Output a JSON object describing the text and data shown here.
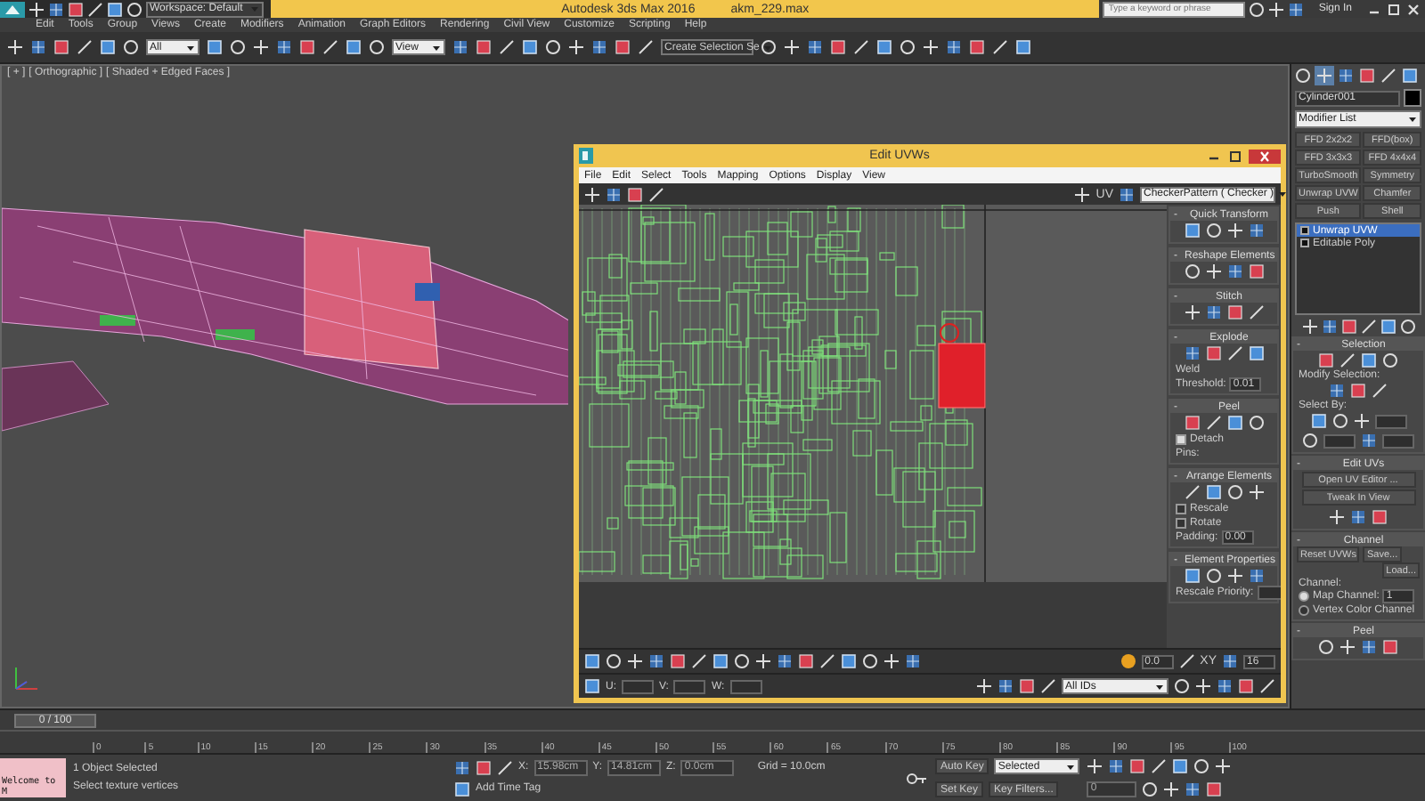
{
  "title_bar": {
    "workspace": "Workspace: Default",
    "app_title": "Autodesk 3ds Max 2016",
    "file_name": "akm_229.max",
    "search": {
      "placeholder": "Type a keyword or phrase"
    },
    "sign_in": "Sign In"
  },
  "menu_bar": [
    "Edit",
    "Tools",
    "Group",
    "Views",
    "Create",
    "Modifiers",
    "Animation",
    "Graph Editors",
    "Rendering",
    "Civil View",
    "Customize",
    "Scripting",
    "Help"
  ],
  "main_toolbar": {
    "filter": "All",
    "reference_coord": "View",
    "selection_set": "Create Selection Se"
  },
  "viewport": {
    "labels": [
      "[ + ]",
      "[ Orthographic ]",
      "[ Shaded + Edged Faces ]"
    ]
  },
  "edit_uvw": {
    "title": "Edit UVWs",
    "menu": [
      "File",
      "Edit",
      "Select",
      "Tools",
      "Mapping",
      "Options",
      "Display",
      "View"
    ],
    "uv_label": "UV",
    "map_dropdown": "CheckerPattern  ( Checker )",
    "rollouts": [
      {
        "sign": "-",
        "title": "Quick Transform"
      },
      {
        "sign": "-",
        "title": "Reshape Elements"
      },
      {
        "sign": "-",
        "title": "Stitch"
      },
      {
        "sign": "-",
        "title": "Explode",
        "controls": [
          {
            "kind": "label",
            "text": "Weld"
          },
          {
            "kind": "spinner",
            "label": "Threshold:",
            "value": "0.01"
          }
        ]
      },
      {
        "sign": "-",
        "title": "Peel",
        "controls": [
          {
            "kind": "checkbox",
            "label": "Detach",
            "checked": true
          },
          {
            "kind": "label",
            "text": "Pins:"
          }
        ]
      },
      {
        "sign": "-",
        "title": "Arrange Elements",
        "controls": [
          {
            "kind": "checkbox",
            "label": "Rescale",
            "checked": false
          },
          {
            "kind": "checkbox",
            "label": "Rotate",
            "checked": false
          },
          {
            "kind": "spinner",
            "label": "Padding:",
            "value": "0.00"
          }
        ]
      },
      {
        "sign": "-",
        "title": "Element Properties",
        "controls": [
          {
            "kind": "spinner",
            "label": "Rescale Priority:"
          }
        ]
      }
    ],
    "bottom": {
      "spinner_a": "0.0",
      "xy_label": "XY",
      "spinner_b": "16",
      "u": "U:",
      "v": "V:",
      "w": "W:",
      "ids_dropdown": "All IDs"
    }
  },
  "command_panel": {
    "tabs": [
      {
        "selected": false
      },
      {
        "selected": true
      },
      {
        "selected": false
      },
      {
        "selected": false
      },
      {
        "selected": false
      },
      {
        "selected": false
      }
    ],
    "object_name": "Cylinder001",
    "modifier_list": "Modifier List",
    "modifier_buttons": [
      "FFD 2x2x2",
      "FFD(box)",
      "FFD 3x3x3",
      "FFD 4x4x4",
      "TurboSmooth",
      "Symmetry",
      "Unwrap UVW",
      "Chamfer",
      "Push",
      "Shell"
    ],
    "stack": [
      {
        "label": "Unwrap UVW",
        "selected": true
      },
      {
        "label": "Editable Poly",
        "selected": false
      }
    ],
    "selection": {
      "sign": "-",
      "title": "Selection",
      "modify_selection": "Modify Selection:",
      "select_by": "Select By:"
    },
    "edit_uvs": {
      "sign": "-",
      "title": "Edit UVs",
      "buttons": [
        "Open UV Editor ...",
        "Tweak In View"
      ]
    },
    "channel": {
      "sign": "-",
      "title": "Channel",
      "reset": "Reset UVWs",
      "save": "Save...",
      "load": "Load...",
      "group": "Channel:",
      "options": [
        {
          "label": "Map Channel:",
          "selected": true
        },
        {
          "label": "Vertex Color Channel",
          "selected": false
        }
      ],
      "map_channel": "1"
    },
    "peel": {
      "sign": "-",
      "title": "Peel"
    }
  },
  "time_slider": {
    "frame": "0 / 100",
    "ticks": [
      "0",
      "5",
      "10",
      "15",
      "20",
      "25",
      "30",
      "35",
      "40",
      "45",
      "50",
      "55",
      "60",
      "65",
      "70",
      "75",
      "80",
      "85",
      "90",
      "95",
      "100"
    ]
  },
  "status_bar": {
    "maxscript": "Welcome to M",
    "selected_count": "1 Object Selected",
    "prompt": "Select texture vertices",
    "x_label": "X:",
    "x": "15.98cm",
    "y_label": "Y:",
    "y": "14.81cm",
    "z_label": "Z:",
    "z": "0.0cm",
    "grid": "Grid = 10.0cm",
    "add_time_tag": "Add Time Tag",
    "auto_key": "Auto Key",
    "key_mode": "Selected",
    "set_key": "Set Key",
    "key_filters": "Key Filters...",
    "current_frame": "0"
  }
}
